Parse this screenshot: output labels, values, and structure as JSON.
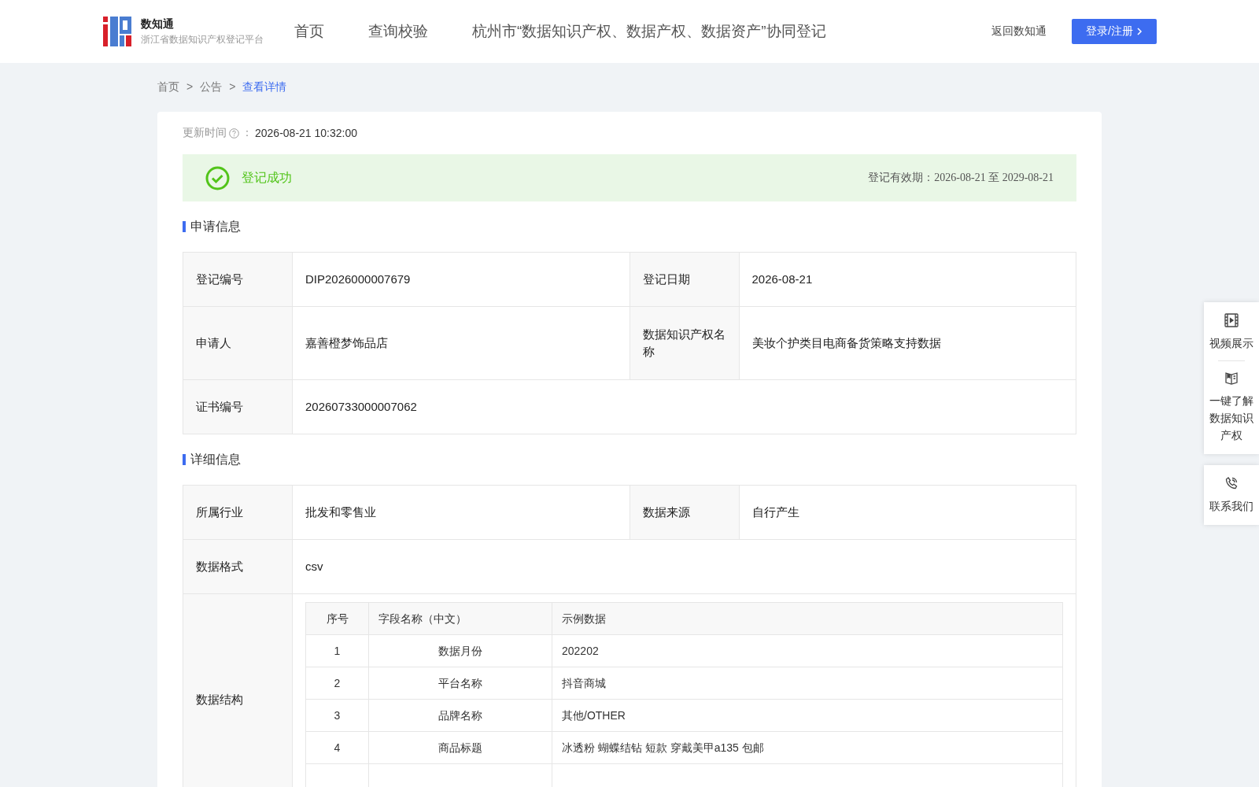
{
  "header": {
    "logo_title": "数知通",
    "logo_subtitle": "浙江省数据知识产权登记平台",
    "nav": [
      {
        "label": "首页",
        "selected": false
      },
      {
        "label": "查询校验",
        "selected": false
      },
      {
        "label": "杭州市“数据知识产权、数据产权、数据资产”协同登记",
        "selected": false
      }
    ],
    "back_link": "返回数知通",
    "login_button": "登录/注册"
  },
  "breadcrumb": [
    {
      "label": "首页",
      "selected": false
    },
    {
      "label": "公告",
      "selected": false
    },
    {
      "label": "查看详情",
      "selected": true
    }
  ],
  "breadcrumb_separator": ">",
  "update": {
    "label": "更新时间",
    "separator": "：",
    "value": "2026-08-21 10:32:00"
  },
  "status": {
    "text": "登记成功",
    "kind": "success",
    "validity": "登记有效期：2026-08-21 至 2029-08-21"
  },
  "sections": [
    {
      "title": "申请信息",
      "rows": [
        [
          {
            "label": "登记编号",
            "value": "DIP2026000007679"
          },
          {
            "label": "登记日期",
            "value": "2026-08-21"
          }
        ],
        [
          {
            "label": "申请人",
            "value": "嘉善橙梦饰品店"
          },
          {
            "label": "数据知识产权名称",
            "value": "美妆个护类目电商备货策略支持数据"
          }
        ],
        [
          {
            "label": "证书编号",
            "value": "20260733000007062"
          }
        ]
      ]
    },
    {
      "title": "详细信息",
      "rows": [
        [
          {
            "label": "所属行业",
            "value": "批发和零售业"
          },
          {
            "label": "数据来源",
            "value": "自行产生"
          }
        ],
        [
          {
            "label": "数据格式",
            "value": "csv"
          }
        ]
      ],
      "structure": {
        "label": "数据结构",
        "columns": [
          "序号",
          "字段名称（中文）",
          "示例数据"
        ],
        "rows": [
          [
            "1",
            "数据月份",
            "202202"
          ],
          [
            "2",
            "平台名称",
            "抖音商城"
          ],
          [
            "3",
            "品牌名称",
            "其他/OTHER"
          ],
          [
            "4",
            "商品标题",
            "冰透粉 蝴蝶结钻 短款 穿戴美甲a135 包邮"
          ]
        ]
      }
    }
  ],
  "side_panel": [
    {
      "kind": "video",
      "label": "视频展示"
    },
    {
      "kind": "book",
      "label": "一键了解数据知识产权"
    },
    {
      "kind": "phone",
      "label": "联系我们"
    }
  ]
}
